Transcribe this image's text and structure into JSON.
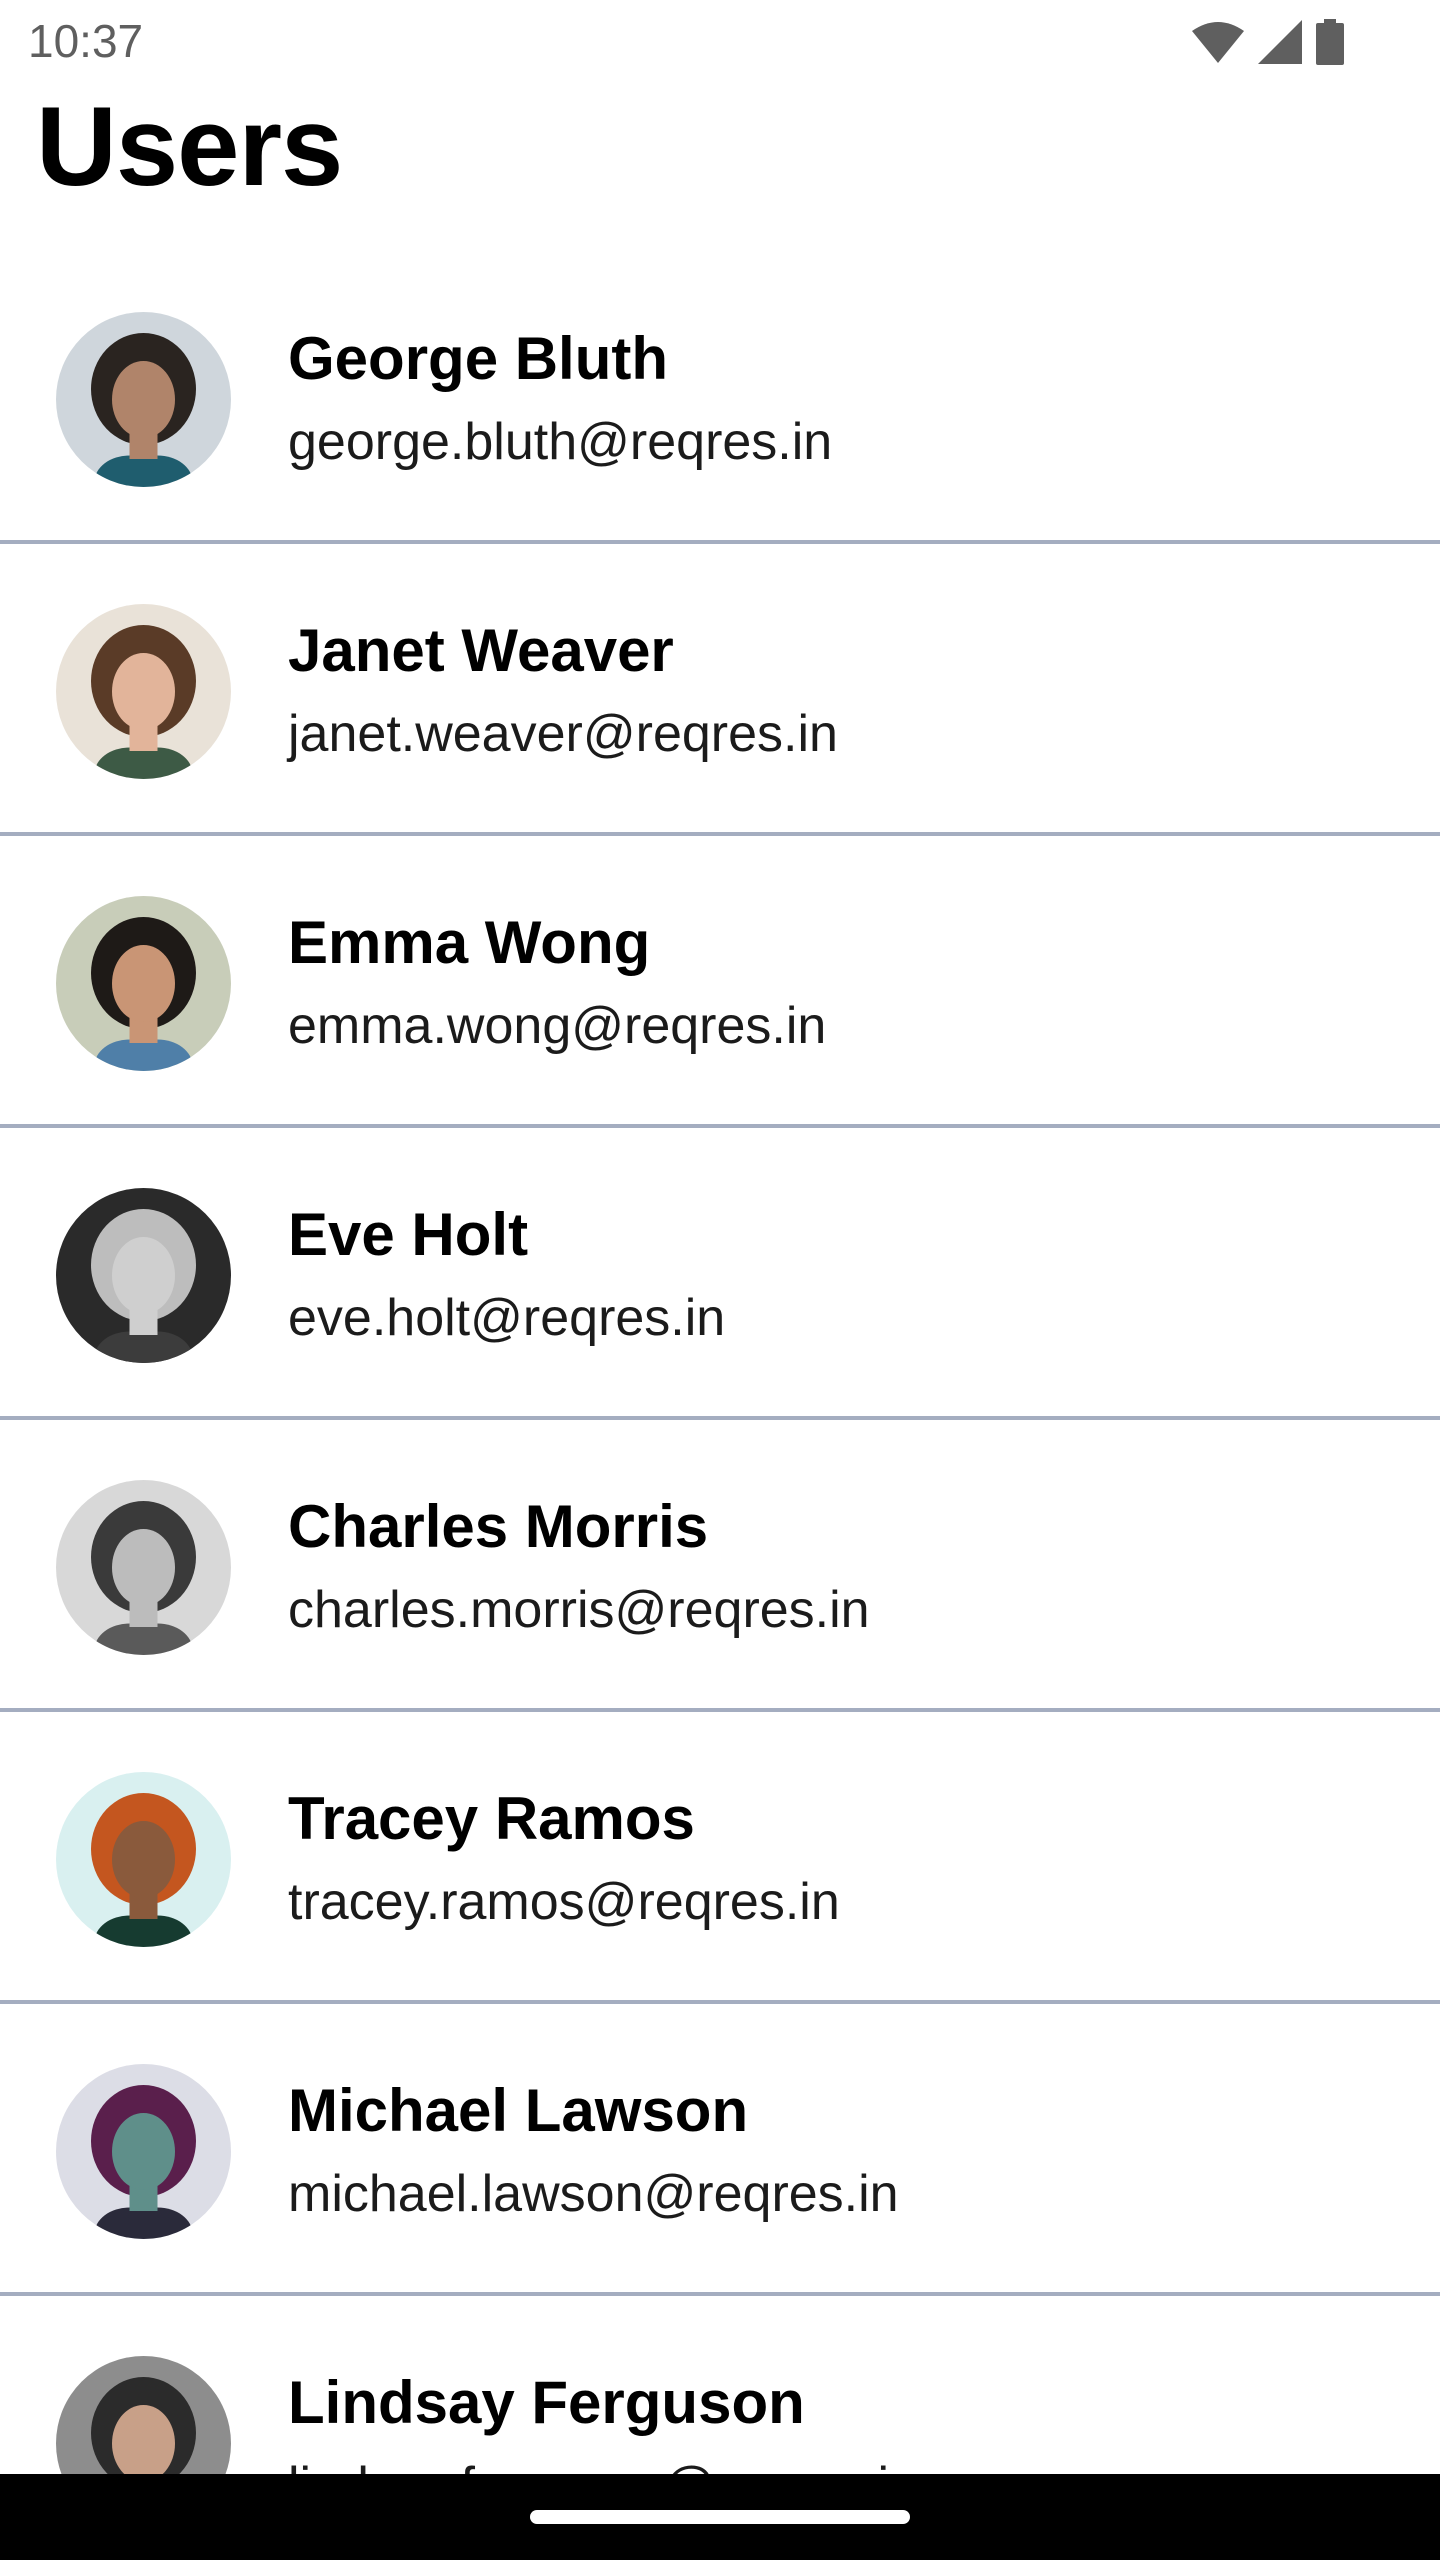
{
  "status_bar": {
    "time": "10:37",
    "icons": [
      "wifi-icon",
      "cellular-signal-icon",
      "battery-icon"
    ]
  },
  "title": "Users",
  "users": [
    {
      "name": "George Bluth",
      "email": "george.bluth@reqres.in",
      "avatar_colors": {
        "bg": "#cfd6dc",
        "hair": "#2a2420",
        "skin": "#b0846a",
        "shirt": "#1f5d6e"
      }
    },
    {
      "name": "Janet Weaver",
      "email": "janet.weaver@reqres.in",
      "avatar_colors": {
        "bg": "#e9e2d8",
        "hair": "#5a3b27",
        "skin": "#e2b49a",
        "shirt": "#3d5a45"
      }
    },
    {
      "name": "Emma Wong",
      "email": "emma.wong@reqres.in",
      "avatar_colors": {
        "bg": "#c8cdb9",
        "hair": "#1e1a17",
        "skin": "#c99575",
        "shirt": "#4f7fa8"
      }
    },
    {
      "name": "Eve Holt",
      "email": "eve.holt@reqres.in",
      "avatar_colors": {
        "bg": "#2a2a2a",
        "hair": "#bdbdbd",
        "skin": "#cfcfcf",
        "shirt": "#3c3c3c"
      }
    },
    {
      "name": "Charles Morris",
      "email": "charles.morris@reqres.in",
      "avatar_colors": {
        "bg": "#d8d8d8",
        "hair": "#3a3a3a",
        "skin": "#bcbcbc",
        "shirt": "#5a5a5a"
      }
    },
    {
      "name": "Tracey Ramos",
      "email": "tracey.ramos@reqres.in",
      "avatar_colors": {
        "bg": "#d9f0f0",
        "hair": "#c4561f",
        "skin": "#8a5a3c",
        "shirt": "#163b30"
      }
    },
    {
      "name": "Michael Lawson",
      "email": "michael.lawson@reqres.in",
      "avatar_colors": {
        "bg": "#dcdde6",
        "hair": "#5a1f4c",
        "skin": "#5f8f8a",
        "shirt": "#2a2a3a"
      }
    },
    {
      "name": "Lindsay Ferguson",
      "email": "lindsay.ferguson@reqres.in",
      "avatar_colors": {
        "bg": "#8d8d8d",
        "hair": "#2b2b2b",
        "skin": "#c8a088",
        "shirt": "#555555"
      }
    }
  ],
  "colors": {
    "divider": "#a4adc0",
    "nav_bar": "#000000"
  }
}
